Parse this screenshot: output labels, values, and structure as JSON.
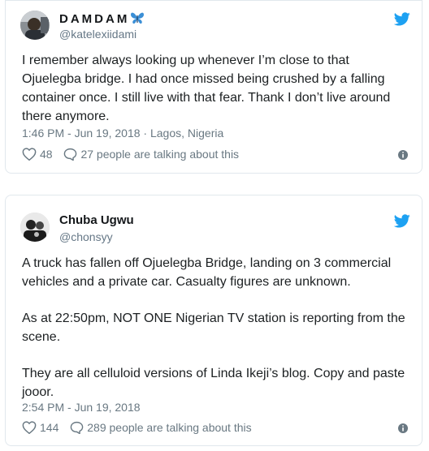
{
  "tweets": [
    {
      "name": "DAMDAM",
      "handle": "@katelexiidami",
      "paragraphs": [
        "I remember always looking up whenever I’m close to that Ojuelegba bridge. I had once missed being crushed by a falling container once. I still live with that fear. Thank I don’t live around there anymore."
      ],
      "meta": "1:46 PM - Jun 19, 2018 · Lagos, Nigeria",
      "likes": "48",
      "talking": "27 people are talking about this"
    },
    {
      "name": "Chuba Ugwu",
      "handle": "@chonsyy",
      "paragraphs": [
        "A truck has fallen off Ojuelegba Bridge, landing on 3 commercial vehicles and a private car. Casualty figures are unknown.",
        "As at 22:50pm, NOT ONE Nigerian TV station is reporting from the scene.",
        "They are all celluloid versions of Linda Ikeji’s blog. Copy and paste jooor."
      ],
      "meta": "2:54 PM - Jun 19, 2018",
      "likes": "144",
      "talking": "289 people are talking about this"
    }
  ],
  "colors": {
    "twitter_blue": "#1da1f2",
    "butterfly_blue": "#3b8fd6",
    "muted": "#697882",
    "border": "#e1e8ed"
  },
  "icons": [
    "butterfly-emoji",
    "twitter-bird-icon",
    "heart-icon",
    "reply-bubble-icon",
    "info-icon"
  ]
}
